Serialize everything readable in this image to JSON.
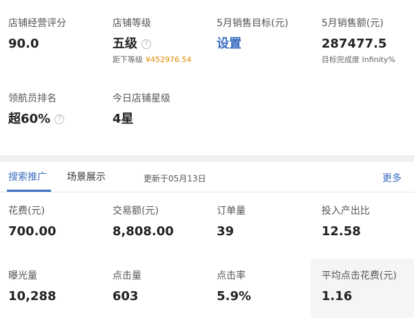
{
  "shop": {
    "score": {
      "label": "店铺经营评分",
      "value": "90.0"
    },
    "level": {
      "label": "店铺等级",
      "value": "五级",
      "sub_label": "距下等级",
      "sub_value": "¥452976.54"
    },
    "target": {
      "label": "5月销售目标(元)",
      "value": "设置"
    },
    "sales": {
      "label": "5月销售额(元)",
      "value": "287477.5",
      "sub": "目标完成度 Infinity%"
    },
    "rank": {
      "label": "领航员排名",
      "value": "超60%"
    },
    "stars": {
      "label": "今日店铺星级",
      "value": "4星"
    }
  },
  "promo": {
    "tabs": [
      {
        "label": "搜索推广",
        "active": true
      },
      {
        "label": "场景展示",
        "active": false
      }
    ],
    "updated": "更新于05月13日",
    "more": "更多",
    "metrics": [
      {
        "label": "花费(元)",
        "value": "700.00"
      },
      {
        "label": "交易额(元)",
        "value": "8,808.00"
      },
      {
        "label": "订单量",
        "value": "39"
      },
      {
        "label": "投入产出比",
        "value": "12.58"
      },
      {
        "label": "曝光量",
        "value": "10,288"
      },
      {
        "label": "点击量",
        "value": "603"
      },
      {
        "label": "点击率",
        "value": "5.9%"
      },
      {
        "label": "平均点击花费(元)",
        "value": "1.16"
      }
    ]
  },
  "icons": {
    "help": "help-circle-icon"
  },
  "colors": {
    "accent": "#3a6ebf",
    "money": "#e08a00"
  }
}
